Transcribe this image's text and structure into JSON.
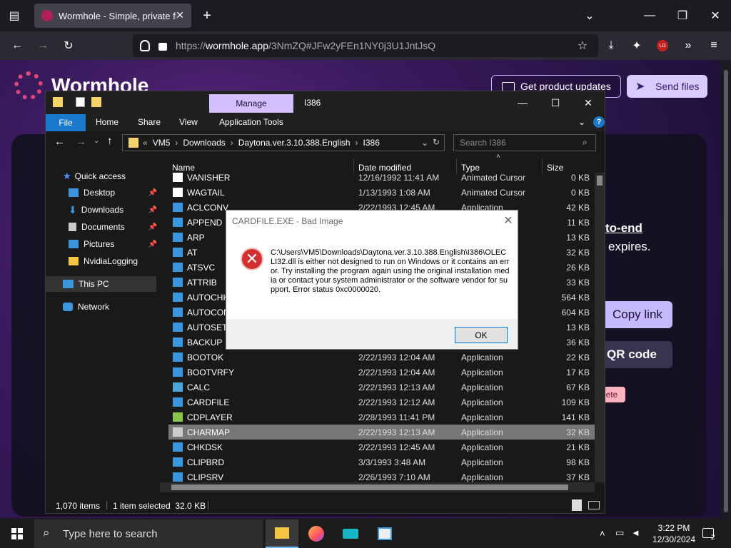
{
  "browser": {
    "tab_title": "Wormhole - Simple, private file",
    "url_prefix": "https://",
    "url_host": "wormhole.app",
    "url_path": "/3NmZQ#JFw2yFEn1NY0j3U1JntJsQ",
    "extension_badge": "LO"
  },
  "page": {
    "brand": "Wormhole",
    "get_updates_label": "Get product updates",
    "send_files_label": "Send files",
    "e2e_fragment": "to-end",
    "expires_fragment": "expires.",
    "copy_link_label": "Copy link",
    "qr_label": "QR code",
    "delete_fragment": "lete"
  },
  "explorer": {
    "manage_label": "Manage",
    "window_title": "I386",
    "ribbon": {
      "file": "File",
      "home": "Home",
      "share": "Share",
      "view": "View",
      "app_tools": "Application Tools"
    },
    "breadcrumb": {
      "overflow": "«",
      "items": [
        "VM5",
        "Downloads",
        "Daytona.ver.3.10.388.English",
        "I386"
      ]
    },
    "search_placeholder": "Search I386",
    "nav": [
      {
        "label": "Quick access",
        "icon": "star-icon",
        "color": "#4a9eff"
      },
      {
        "label": "Desktop",
        "icon": "desktop-icon",
        "color": "#3a96dd"
      },
      {
        "label": "Downloads",
        "icon": "download-icon",
        "color": "#3a96dd"
      },
      {
        "label": "Documents",
        "icon": "document-icon",
        "color": "#cccccc"
      },
      {
        "label": "Pictures",
        "icon": "pictures-icon",
        "color": "#3a96dd"
      },
      {
        "label": "NvidiaLogging",
        "icon": "folder-icon",
        "color": "#f4c542"
      },
      {
        "label": "This PC",
        "icon": "computer-icon",
        "color": "#3a96dd"
      },
      {
        "label": "Network",
        "icon": "network-icon",
        "color": "#3a96dd"
      }
    ],
    "columns": {
      "name": "Name",
      "date": "Date modified",
      "type": "Type",
      "size": "Size"
    },
    "files": [
      {
        "name": "VANISHER",
        "date": "12/16/1992 11:41 AM",
        "type": "Animated Cursor",
        "size": "0 KB",
        "icon": "file-icon"
      },
      {
        "name": "WAGTAIL",
        "date": "1/13/1993 1:08 AM",
        "type": "Animated Cursor",
        "size": "0 KB",
        "icon": "file-icon"
      },
      {
        "name": "ACLCONV",
        "date": "2/22/1993 12:45 AM",
        "type": "Application",
        "size": "42 KB",
        "icon": "app-icon"
      },
      {
        "name": "APPEND",
        "date": "",
        "type": "",
        "size": "11 KB",
        "icon": "app-icon"
      },
      {
        "name": "ARP",
        "date": "",
        "type": "",
        "size": "13 KB",
        "icon": "app-icon"
      },
      {
        "name": "AT",
        "date": "",
        "type": "",
        "size": "32 KB",
        "icon": "app-icon"
      },
      {
        "name": "ATSVC",
        "date": "",
        "type": "",
        "size": "26 KB",
        "icon": "app-icon"
      },
      {
        "name": "ATTRIB",
        "date": "",
        "type": "",
        "size": "33 KB",
        "icon": "app-icon"
      },
      {
        "name": "AUTOCHK",
        "date": "",
        "type": "",
        "size": "564 KB",
        "icon": "app-icon"
      },
      {
        "name": "AUTOCON",
        "date": "",
        "type": "",
        "size": "604 KB",
        "icon": "app-icon"
      },
      {
        "name": "AUTOSETP",
        "date": "",
        "type": "",
        "size": "13 KB",
        "icon": "app-icon"
      },
      {
        "name": "BACKUP",
        "date": "",
        "type": "",
        "size": "36 KB",
        "icon": "app-icon"
      },
      {
        "name": "BOOTOK",
        "date": "2/22/1993 12:04 AM",
        "type": "Application",
        "size": "22 KB",
        "icon": "app-icon"
      },
      {
        "name": "BOOTVRFY",
        "date": "2/22/1993 12:04 AM",
        "type": "Application",
        "size": "17 KB",
        "icon": "app-icon"
      },
      {
        "name": "CALC",
        "date": "2/22/1993 12:13 AM",
        "type": "Application",
        "size": "67 KB",
        "icon": "calc-icon"
      },
      {
        "name": "CARDFILE",
        "date": "2/22/1993 12:12 AM",
        "type": "Application",
        "size": "109 KB",
        "icon": "cardfile-icon"
      },
      {
        "name": "CDPLAYER",
        "date": "2/28/1993 11:41 PM",
        "type": "Application",
        "size": "141 KB",
        "icon": "cdplayer-icon"
      },
      {
        "name": "CHARMAP",
        "date": "2/22/1993 12:13 AM",
        "type": "Application",
        "size": "32 KB",
        "icon": "charmap-icon",
        "selected": true
      },
      {
        "name": "CHKDSK",
        "date": "2/22/1993 12:45 AM",
        "type": "Application",
        "size": "21 KB",
        "icon": "app-icon"
      },
      {
        "name": "CLIPBRD",
        "date": "3/3/1993 3:48 AM",
        "type": "Application",
        "size": "98 KB",
        "icon": "app-icon"
      },
      {
        "name": "CLIPSRV",
        "date": "2/26/1993 7:10 AM",
        "type": "Application",
        "size": "37 KB",
        "icon": "app-icon"
      }
    ],
    "status": {
      "count": "1,070 items",
      "selection": "1 item selected  32.0 KB"
    }
  },
  "dialog": {
    "title": "CARDFILE.EXE - Bad Image",
    "message": "C:\\Users\\VM5\\Downloads\\Daytona.ver.3.10.388.English\\I386\\OLECLI32.dll is either not designed to run on Windows or it contains an error. Try installing the program again using the original installation media or contact your system administrator or the software vendor for support. Error status 0xc0000020.",
    "ok_label": "OK"
  },
  "taskbar": {
    "search_placeholder": "Type here to search",
    "time": "3:22 PM",
    "date": "12/30/2024",
    "notifications": "2"
  }
}
